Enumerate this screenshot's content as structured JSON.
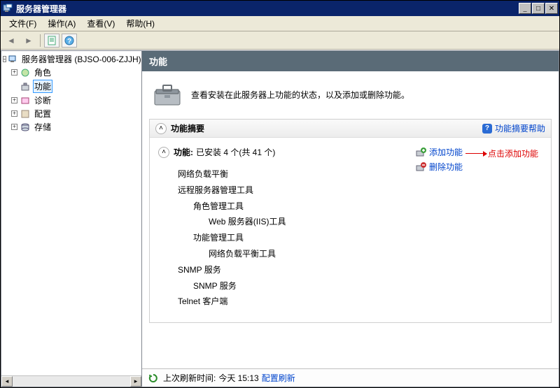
{
  "window": {
    "title": "服务器管理器"
  },
  "menu": {
    "file": "文件(F)",
    "action": "操作(A)",
    "view": "查看(V)",
    "help": "帮助(H)"
  },
  "tree": {
    "root": "服务器管理器 (BJSO-006-ZJJH)",
    "roles": "角色",
    "features": "功能",
    "diagnostics": "诊断",
    "configuration": "配置",
    "storage": "存储"
  },
  "content": {
    "header": "功能",
    "intro": "查看安装在此服务器上功能的状态，以及添加或删除功能。"
  },
  "summary": {
    "title": "功能摘要",
    "help": "功能摘要帮助",
    "features_label": "功能:",
    "installed_text": "已安装 4 个(共 41 个)",
    "add_feature": "添加功能",
    "remove_feature": "删除功能",
    "annotation": "点击添加功能",
    "list": [
      "网络负载平衡",
      "远程服务器管理工具",
      "角色管理工具",
      "Web 服务器(IIS)工具",
      "功能管理工具",
      "网络负载平衡工具",
      "SNMP 服务",
      "SNMP 服务",
      "Telnet 客户端"
    ]
  },
  "status": {
    "label": "上次刷新时间:",
    "time": "今天 15:13",
    "link": "配置刷新"
  }
}
